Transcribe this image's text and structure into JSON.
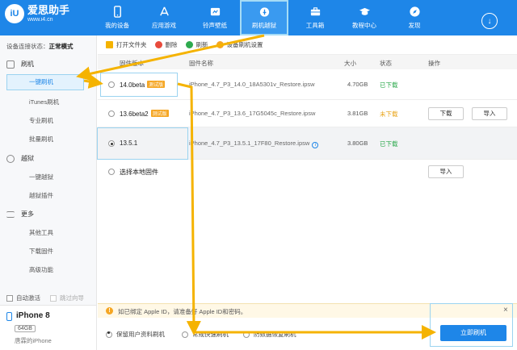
{
  "app": {
    "title": "爱思助手",
    "url": "www.i4.cn",
    "logo_mark": "iU"
  },
  "nav": {
    "items": [
      {
        "label": "我的设备",
        "icon": "phone-icon"
      },
      {
        "label": "应用游戏",
        "icon": "app-store-icon"
      },
      {
        "label": "铃声壁纸",
        "icon": "wallpaper-icon"
      },
      {
        "label": "刷机越狱",
        "icon": "flash-icon",
        "active": true
      },
      {
        "label": "工具箱",
        "icon": "toolbox-icon"
      },
      {
        "label": "教程中心",
        "icon": "graduation-cap-icon"
      },
      {
        "label": "发现",
        "icon": "compass-icon"
      }
    ]
  },
  "sidebar": {
    "status_label": "设备连接状态：",
    "status_value": "正常模式",
    "groups": [
      {
        "label": "刷机",
        "items": [
          "一键刷机",
          "iTunes刷机",
          "专业刷机",
          "批量刷机"
        ]
      },
      {
        "label": "越狱",
        "items": [
          "一键越狱",
          "越狱插件"
        ]
      },
      {
        "label": "更多",
        "items": [
          "其他工具",
          "下载固件",
          "高级功能"
        ]
      }
    ],
    "auto_activate": "自动激活",
    "skip_guide": "跳过向导",
    "device": {
      "name": "iPhone 8",
      "capacity": "64GB",
      "owner": "唐霖的iPhone"
    }
  },
  "toolbar": {
    "open_folder": "打开文件夹",
    "delete": "删除",
    "refresh": "刷新",
    "settings": "设备刷机设置"
  },
  "table": {
    "headers": {
      "version": "固件版本",
      "name": "固件名称",
      "size": "大小",
      "status": "状态",
      "action": "操作"
    },
    "rows": [
      {
        "version": "14.0beta",
        "badge": "测试版",
        "name": "iPhone_4.7_P3_14.0_18A5301v_Restore.ipsw",
        "size": "4.70GB",
        "status": "已下载",
        "downloaded": true,
        "selected": false
      },
      {
        "version": "13.6beta2",
        "badge": "测试版",
        "name": "iPhone_4.7_P3_13.6_17G5045c_Restore.ipsw",
        "size": "3.81GB",
        "status": "未下载",
        "downloaded": false,
        "download_btn": "下载",
        "import_btn": "导入",
        "selected": false
      },
      {
        "version": "13.5.1",
        "badge": "",
        "name": "iPhone_4.7_P3_13.5.1_17F80_Restore.ipsw",
        "size": "3.80GB",
        "status": "已下载",
        "downloaded": true,
        "selected": true,
        "info": "i"
      }
    ],
    "local": {
      "label": "选择本地固件",
      "import_btn": "导入"
    }
  },
  "notice": {
    "icon": "!",
    "text": "如已绑定 Apple ID，请准备好 Apple ID和密码。",
    "close": "×"
  },
  "options": {
    "keep_data": "保留用户资料刷机",
    "normal_quick": "常规快速刷机",
    "anti_recovery": "防数据恢复刷机",
    "flash_button": "立即刷机"
  },
  "colors": {
    "brand": "#1e86e8",
    "highlight": "#9bd3f0",
    "arrow": "#f5b300",
    "badge": "#f5a623",
    "status_ok": "#2eaa4e",
    "status_pending": "#e8a317"
  }
}
